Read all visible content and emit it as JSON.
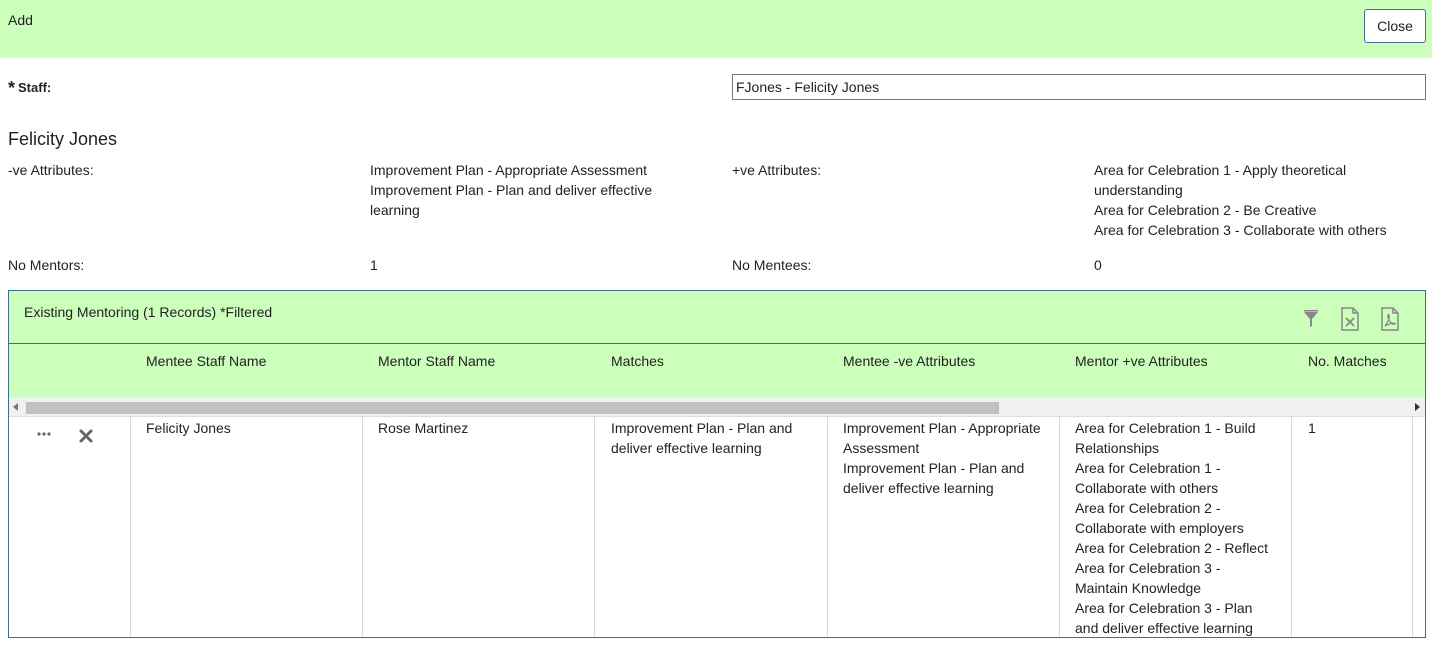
{
  "header": {
    "title": "Add",
    "close_label": "Close"
  },
  "staff": {
    "required_marker": "*",
    "label": "Staff:",
    "value": "FJones - Felicity Jones"
  },
  "person": {
    "name": "Felicity Jones",
    "neg_label": "-ve Attributes:",
    "neg_lines": [
      "Improvement Plan - Appropriate Assessment",
      "Improvement Plan - Plan and deliver effective",
      "learning"
    ],
    "pos_label": "+ve Attributes:",
    "pos_lines": [
      "Area for Celebration 1 - Apply theoretical",
      "understanding",
      "Area for Celebration 2 - Be Creative",
      "Area for Celebration 3 - Collaborate with others"
    ],
    "mentors_label": "No Mentors:",
    "mentors_value": "1",
    "mentees_label": "No Mentees:",
    "mentees_value": "0"
  },
  "panel": {
    "title": "Existing Mentoring (1 Records) *Filtered",
    "icons": [
      "filter-icon",
      "excel-export-icon",
      "pdf-export-icon"
    ],
    "columns": [
      "Mentee Staff Name",
      "Mentor Staff Name",
      "Matches",
      "Mentee -ve Attributes",
      "Mentor +ve Attributes",
      "No. Matches"
    ],
    "row": {
      "mentee": "Felicity Jones",
      "mentor": "Rose Martinez",
      "matches": [
        "Improvement Plan - Plan and",
        "deliver effective learning"
      ],
      "mentee_neg": [
        "Improvement Plan - Appropriate",
        "Assessment",
        "Improvement Plan - Plan and",
        "deliver effective learning"
      ],
      "mentor_pos": [
        "Area for Celebration 1 - Build",
        "Relationships",
        "Area for Celebration 1 -",
        "Collaborate with others",
        "Area for Celebration 2 -",
        "Collaborate with employers",
        "Area for Celebration 2 - Reflect",
        "Area for Celebration 3 -",
        "Maintain Knowledge",
        "Area for Celebration 3 - Plan",
        "and deliver effective learning"
      ],
      "num_matches": "1"
    }
  },
  "colors": {
    "accent_green": "#ccffbb",
    "border_blue": "#3a6f9a"
  }
}
